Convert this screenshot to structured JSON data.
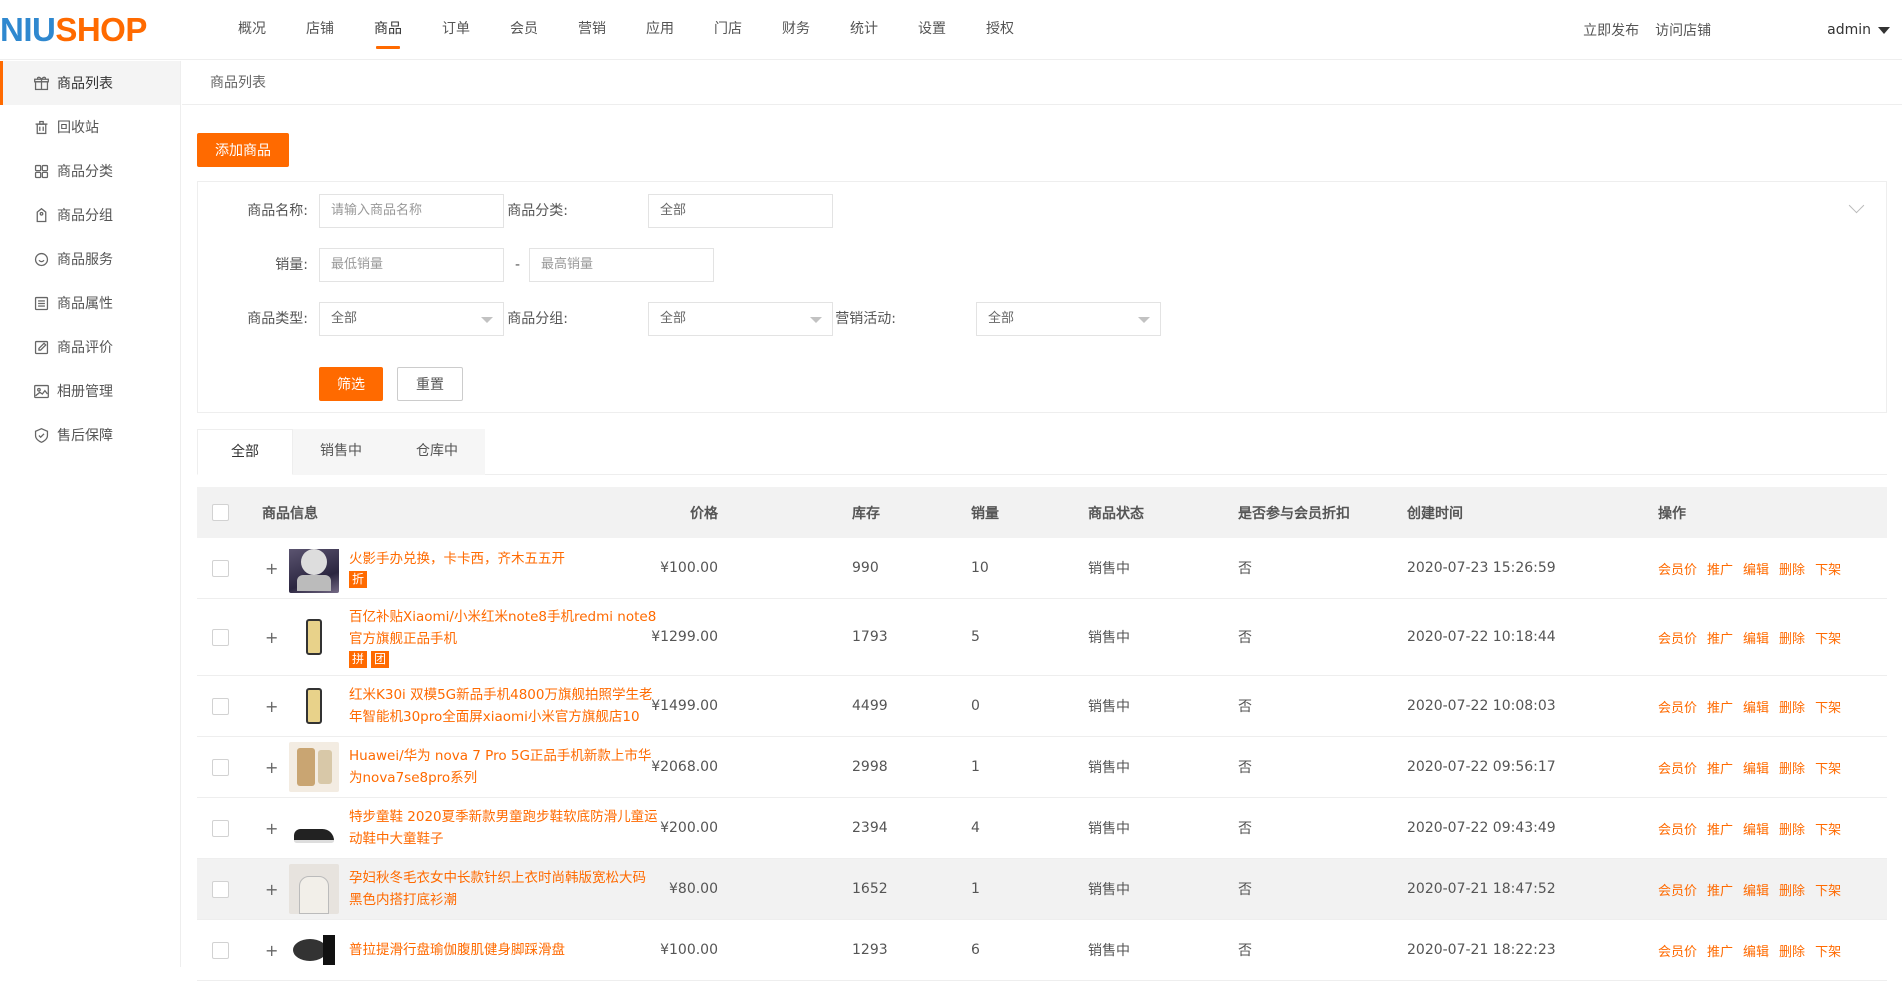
{
  "logo": {
    "part1": "NIU",
    "part2": "SHOP"
  },
  "top_nav": [
    "概况",
    "店铺",
    "商品",
    "订单",
    "会员",
    "营销",
    "应用",
    "门店",
    "财务",
    "统计",
    "设置",
    "授权"
  ],
  "top_right": {
    "publish": "立即发布",
    "visit": "访问店铺",
    "user": "admin"
  },
  "sidebar": [
    {
      "label": "商品列表",
      "icon": "gift-icon"
    },
    {
      "label": "回收站",
      "icon": "trash-icon"
    },
    {
      "label": "商品分类",
      "icon": "grid-icon"
    },
    {
      "label": "商品分组",
      "icon": "tag-icon"
    },
    {
      "label": "商品服务",
      "icon": "smile-icon"
    },
    {
      "label": "商品属性",
      "icon": "list-icon"
    },
    {
      "label": "商品评价",
      "icon": "edit-icon"
    },
    {
      "label": "相册管理",
      "icon": "image-icon"
    },
    {
      "label": "售后保障",
      "icon": "shield-icon"
    }
  ],
  "breadcrumb": "商品列表",
  "add_button": "添加商品",
  "filter": {
    "name_label": "商品名称:",
    "name_placeholder": "请输入商品名称",
    "category_label": "商品分类:",
    "category_value": "全部",
    "sales_label": "销量:",
    "sales_min_placeholder": "最低销量",
    "sales_dash": "-",
    "sales_max_placeholder": "最高销量",
    "type_label": "商品类型:",
    "type_value": "全部",
    "group_label": "商品分组:",
    "group_value": "全部",
    "promo_label": "营销活动:",
    "promo_value": "全部",
    "submit": "筛选",
    "reset": "重置"
  },
  "tabs": [
    "全部",
    "销售中",
    "仓库中"
  ],
  "table": {
    "headers": {
      "info": "商品信息",
      "price": "价格",
      "stock": "库存",
      "sales": "销量",
      "status": "商品状态",
      "member_discount": "是否参与会员折扣",
      "created": "创建时间",
      "ops": "操作"
    },
    "ops": [
      "会员价",
      "推广",
      "编辑",
      "删除",
      "下架"
    ],
    "rows": [
      {
        "name": "火影手办兑换，卡卡西，齐木五五开",
        "tags": [
          "折"
        ],
        "price": "¥100.00",
        "stock": "990",
        "sales": "10",
        "status": "销售中",
        "discount": "否",
        "created": "2020-07-23 15:26:59"
      },
      {
        "name": "百亿补贴Xiaomi/小米红米note8手机redmi note8官方旗舰正品手机",
        "tags": [
          "拼",
          "团"
        ],
        "price": "¥1299.00",
        "stock": "1793",
        "sales": "5",
        "status": "销售中",
        "discount": "否",
        "created": "2020-07-22 10:18:44"
      },
      {
        "name": "红米K30i 双模5G新品手机4800万旗舰拍照学生老年智能机30pro全面屏xiaomi小米官方旗舰店10",
        "tags": [],
        "price": "¥1499.00",
        "stock": "4499",
        "sales": "0",
        "status": "销售中",
        "discount": "否",
        "created": "2020-07-22 10:08:03"
      },
      {
        "name": "Huawei/华为 nova 7 Pro 5G正品手机新款上市华为nova7se8pro系列",
        "tags": [],
        "price": "¥2068.00",
        "stock": "2998",
        "sales": "1",
        "status": "销售中",
        "discount": "否",
        "created": "2020-07-22 09:56:17"
      },
      {
        "name": "特步童鞋 2020夏季新款男童跑步鞋软底防滑儿童运动鞋中大童鞋子",
        "tags": [],
        "price": "¥200.00",
        "stock": "2394",
        "sales": "4",
        "status": "销售中",
        "discount": "否",
        "created": "2020-07-22 09:43:49"
      },
      {
        "name": "孕妇秋冬毛衣女中长款针织上衣时尚韩版宽松大码黑色内搭打底衫潮",
        "tags": [],
        "price": "¥80.00",
        "stock": "1652",
        "sales": "1",
        "status": "销售中",
        "discount": "否",
        "created": "2020-07-21 18:47:52"
      },
      {
        "name": "普拉提滑行盘瑜伽腹肌健身脚踩滑盘",
        "tags": [],
        "price": "¥100.00",
        "stock": "1293",
        "sales": "6",
        "status": "销售中",
        "discount": "否",
        "created": "2020-07-21 18:22:23"
      }
    ]
  },
  "colors": {
    "accent": "#ff6a00",
    "logo_blue": "#2f88cf"
  }
}
